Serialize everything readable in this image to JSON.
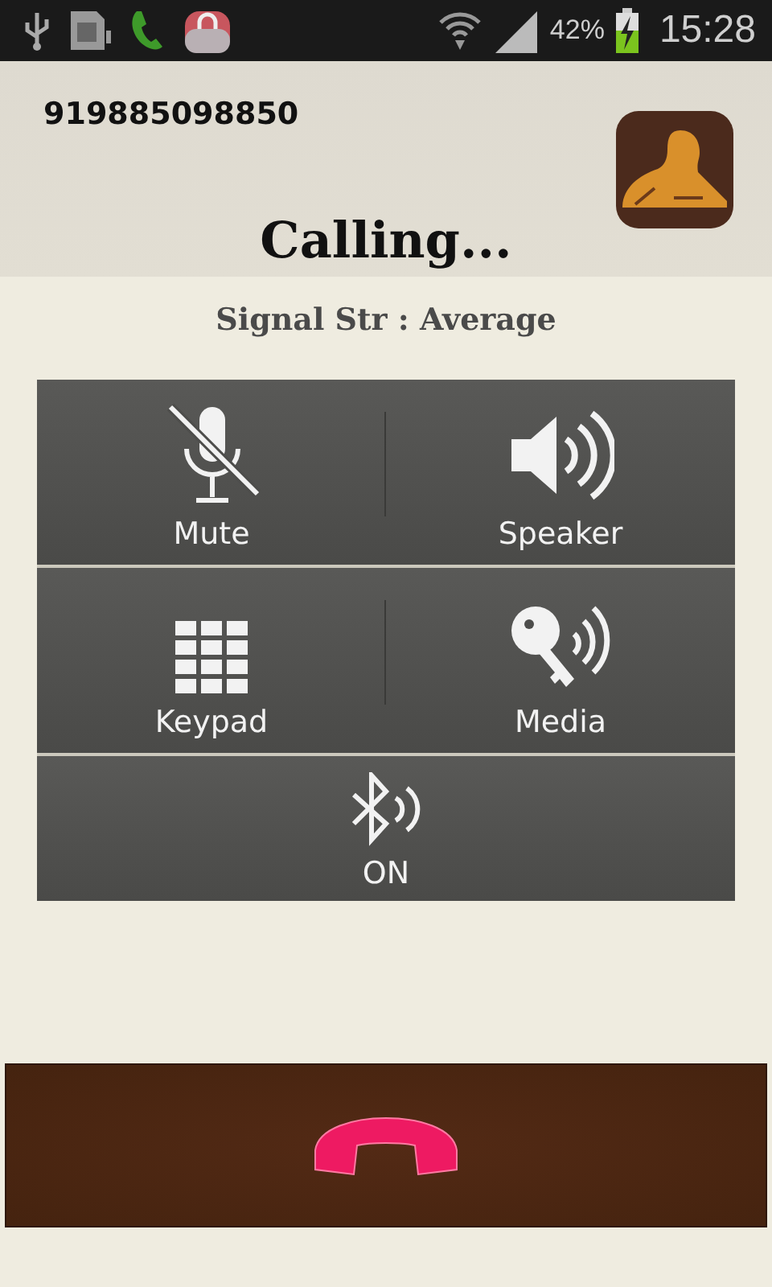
{
  "status_bar": {
    "battery": "42%",
    "time": "15:28"
  },
  "call": {
    "number": "919885098850",
    "status": "Calling...",
    "signal": "Signal Str : Average"
  },
  "controls": [
    {
      "kind": "mute",
      "label": "Mute"
    },
    {
      "kind": "speaker",
      "label": "Speaker"
    },
    {
      "kind": "keypad",
      "label": "Keypad"
    },
    {
      "kind": "media",
      "label": "Media"
    },
    {
      "kind": "bluetooth",
      "label": "ON"
    }
  ]
}
